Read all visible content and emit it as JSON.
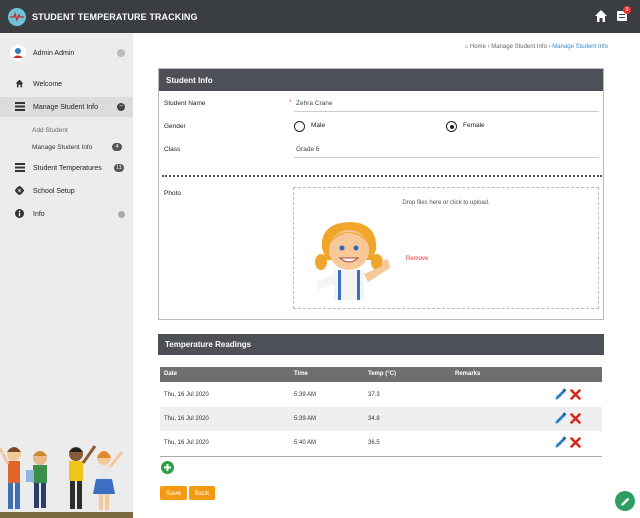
{
  "app": {
    "title": "STUDENT TEMPERATURE TRACKING",
    "notification_count": "0"
  },
  "sidebar": {
    "user_name": "Admin Admin",
    "items": [
      {
        "label": "Welcome",
        "icon": "home-icon"
      },
      {
        "label": "Manage Student Info",
        "icon": "list-icon"
      },
      {
        "label": "Student Temperatures",
        "icon": "list-icon",
        "badge": "11"
      },
      {
        "label": "School Setup",
        "icon": "gear-icon"
      },
      {
        "label": "Info",
        "icon": "info-icon"
      }
    ],
    "subitems": [
      {
        "label": "Add Student"
      },
      {
        "label": "Manage Student Info",
        "badge": "4"
      }
    ]
  },
  "breadcrumb": {
    "home": "Home",
    "parent": "Manage Student Info",
    "current": "Manage Student Info"
  },
  "student_info": {
    "title": "Student Info",
    "name_label": "Student Name",
    "name_value": "Zehra Crane",
    "gender_label": "Gender",
    "gender_options": [
      "Male",
      "Female"
    ],
    "gender_selected": "Female",
    "class_label": "Class",
    "class_value": "Grade 6",
    "photo_label": "Photo",
    "dropzone_text": "Drop files here or click to upload.",
    "remove_label": "Remove"
  },
  "temperature_readings": {
    "title": "Temperature Readings",
    "columns": [
      "Date",
      "Time",
      "Temp (°C)",
      "Remarks"
    ],
    "rows": [
      {
        "date": "Thu, 16 Jul 2020",
        "time": "5:39 AM",
        "temp": "37.3",
        "remarks": ""
      },
      {
        "date": "Thu, 16 Jul 2020",
        "time": "5:39 AM",
        "temp": "34.8",
        "remarks": ""
      },
      {
        "date": "Thu, 16 Jul 2020",
        "time": "5:40 AM",
        "temp": "36.5",
        "remarks": ""
      }
    ]
  },
  "actions": {
    "save": "Save",
    "back": "Back"
  },
  "colors": {
    "topbar": "#3a3d42",
    "accent": "#f39a12",
    "link": "#3a8bd6",
    "danger": "#e33333",
    "fab": "#2f9e63"
  }
}
